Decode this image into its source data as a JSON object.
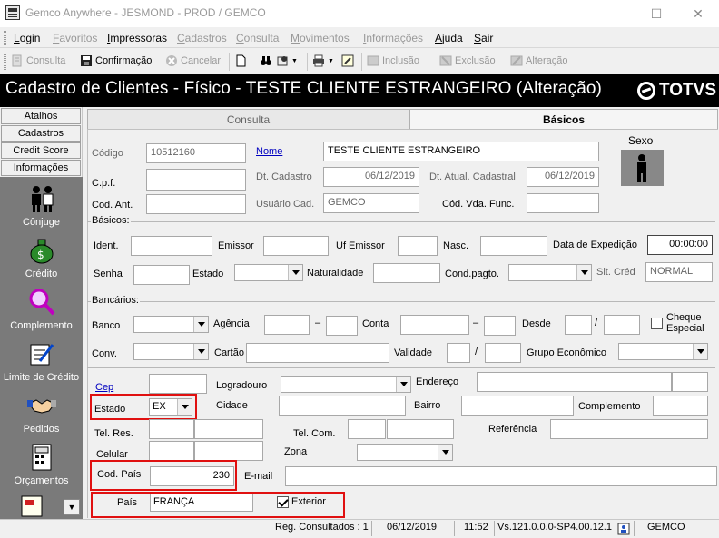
{
  "window": {
    "title": "Gemco Anywhere - JESMOND - PROD / GEMCO"
  },
  "menu": [
    {
      "label": "Login",
      "enabled": true
    },
    {
      "label": "Favoritos",
      "enabled": false
    },
    {
      "label": "Impressoras",
      "enabled": true
    },
    {
      "label": "Cadastros",
      "enabled": false
    },
    {
      "label": "Consulta",
      "enabled": false
    },
    {
      "label": "Movimentos",
      "enabled": false
    },
    {
      "label": "Informações",
      "enabled": false
    },
    {
      "label": "Ajuda",
      "enabled": true
    },
    {
      "label": "Sair",
      "enabled": true
    }
  ],
  "toolbar": {
    "consulta": "Consulta",
    "confirmacao": "Confirmação",
    "cancelar": "Cancelar",
    "inclusao": "Inclusão",
    "exclusao": "Exclusão",
    "alteracao": "Alteração"
  },
  "header": {
    "title": "Cadastro de Clientes - Físico  - TESTE CLIENTE ESTRANGEIRO (Alteração)",
    "logo": "TOTVS"
  },
  "sidebar": {
    "buttons": [
      "Atalhos",
      "Cadastros",
      "Credit Score",
      "Informações"
    ],
    "items": [
      {
        "label": "Cônjuge",
        "icon": "couple-icon"
      },
      {
        "label": "Crédito",
        "icon": "money-bag-icon"
      },
      {
        "label": "Complemento",
        "icon": "magnifier-icon"
      },
      {
        "label": "Limite de Crédito",
        "icon": "document-pen-icon"
      },
      {
        "label": "Pedidos",
        "icon": "handshake-icon"
      },
      {
        "label": "Orçamentos",
        "icon": "calculator-icon"
      }
    ]
  },
  "tabs": {
    "consulta": "Consulta",
    "basicos": "Básicos"
  },
  "form": {
    "codigo_label": "Código",
    "codigo": "10512160",
    "nome_label": "Nome",
    "nome": "TESTE CLIENTE ESTRANGEIRO",
    "sexo_label": "Sexo",
    "cpf_label": "C.p.f.",
    "dt_cadastro_label": "Dt. Cadastro",
    "dt_cadastro": "06/12/2019",
    "dt_atual_label": "Dt. Atual. Cadastral",
    "dt_atual": "06/12/2019",
    "cod_ant_label": "Cod. Ant.",
    "usuario_label": "Usuário Cad.",
    "usuario": "GEMCO",
    "cod_vda_label": "Cód. Vda. Func.",
    "basicos_group": "Básicos:",
    "ident_label": "Ident.",
    "emissor_label": "Emissor",
    "uf_emissor_label": "Uf Emissor",
    "nasc_label": "Nasc.",
    "data_exped_label": "Data de Expedição",
    "data_exped": "00:00:00",
    "senha_label": "Senha",
    "estado_civil_label": "Estado",
    "naturalidade_label": "Naturalidade",
    "cond_pagto_label": "Cond.pagto.",
    "sit_cred_label": "Sit. Créd",
    "sit_cred": "NORMAL",
    "bancarios_group": "Bancários:",
    "banco_label": "Banco",
    "agencia_label": "Agência",
    "conta_label": "Conta",
    "dash": "–",
    "desde_label": "Desde",
    "slash": "/",
    "cheque_label": "Cheque Especial",
    "conv_label": "Conv.",
    "cartao_label": "Cartão",
    "validade_label": "Validade",
    "grupo_eco_label": "Grupo Econômico",
    "cep_label": "Cep",
    "logradouro_label": "Logradouro",
    "endereco_label": "Endereço",
    "estado_label": "Estado",
    "estado": "EX",
    "cidade_label": "Cidade",
    "bairro_label": "Bairro",
    "complemento_label": "Complemento",
    "tel_res_label": "Tel. Res.",
    "tel_com_label": "Tel. Com.",
    "referencia_label": "Referência",
    "celular_label": "Celular",
    "zona_label": "Zona",
    "cod_pais_label": "Cod. País",
    "cod_pais": "230",
    "email_label": "E-mail",
    "pais_label": "País",
    "pais": "FRANÇA",
    "exterior_label": "Exterior",
    "exterior_checked": true
  },
  "status": {
    "reg": "Reg. Consultados : 1",
    "date": "06/12/2019",
    "time": "11:52",
    "version": "Vs.121.0.0.0-SP4.00.12.1",
    "user": "GEMCO"
  }
}
